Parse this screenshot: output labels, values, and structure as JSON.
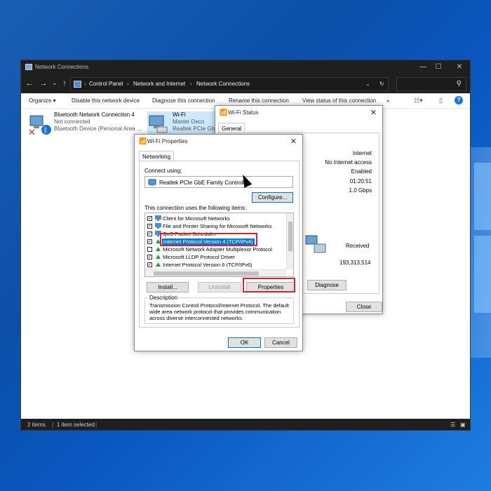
{
  "explorer": {
    "title": "Network Connections",
    "window_controls": {
      "minimize": "—",
      "maximize": "☐",
      "close": "✕"
    },
    "nav": {
      "back": "←",
      "forward": "→",
      "recent": "⌄",
      "up": "↑",
      "refresh": "↻",
      "dropdown": "⌄"
    },
    "breadcrumbs": [
      "Control Panel",
      "Network and Internet",
      "Network Connections"
    ],
    "toolbar": {
      "organize": "Organize ▾",
      "disable": "Disable this network device",
      "diagnose": "Diagnose this connection",
      "rename": "Rename this connection",
      "view_status": "View status of this connection",
      "more": "»"
    },
    "connections": [
      {
        "name": "Bluetooth Network Connection 4",
        "status": "Not connected",
        "device": "Bluetooth Device (Personal Area ..."
      },
      {
        "name": "Wi-Fi",
        "status": "Master Deco",
        "device": "Realtek PCIe GbE"
      }
    ],
    "status_bar": {
      "items": "2 items",
      "selected": "1 item selected"
    }
  },
  "wifi_status": {
    "title": "Wi-Fi Status",
    "tab": "General",
    "values": [
      "Internet",
      "No Internet access",
      "Enabled",
      "01:20:51",
      "1.0 Gbps"
    ],
    "received_label": "Received",
    "received_value": "193,313,514",
    "diagnose_label": "Diagnose",
    "close_label": "Close"
  },
  "wifi_properties": {
    "title": "Wi-Fi Properties",
    "tab": "Networking",
    "connect_using_label": "Connect using:",
    "adapter": "Realtek PCIe GbE Family Controller",
    "configure_label": "Configure...",
    "items_label": "This connection uses the following items:",
    "items": [
      {
        "label": "Client for Microsoft Networks",
        "checked": true
      },
      {
        "label": "File and Printer Sharing for Microsoft Networks",
        "checked": true
      },
      {
        "label": "QoS Packet Scheduler",
        "checked": true
      },
      {
        "label": "Internet Protocol Version 4 (TCP/IPv4)",
        "checked": true,
        "selected": true
      },
      {
        "label": "Microsoft Network Adapter Multiplexor Protocol",
        "checked": false
      },
      {
        "label": "Microsoft LLDP Protocol Driver",
        "checked": true
      },
      {
        "label": "Internet Protocol Version 6 (TCP/IPv6)",
        "checked": true
      }
    ],
    "install_label": "Install...",
    "uninstall_label": "Uninstall",
    "properties_label": "Properties",
    "description_label": "Description",
    "description_text": "Transmission Control Protocol/Internet Protocol. The default wide area network protocol that provides communication across diverse interconnected networks.",
    "ok_label": "OK",
    "cancel_label": "Cancel"
  },
  "colors": {
    "highlight": "#d6242a",
    "selection": "#0078d7",
    "titlebar_dark": "#1f1f1f"
  }
}
